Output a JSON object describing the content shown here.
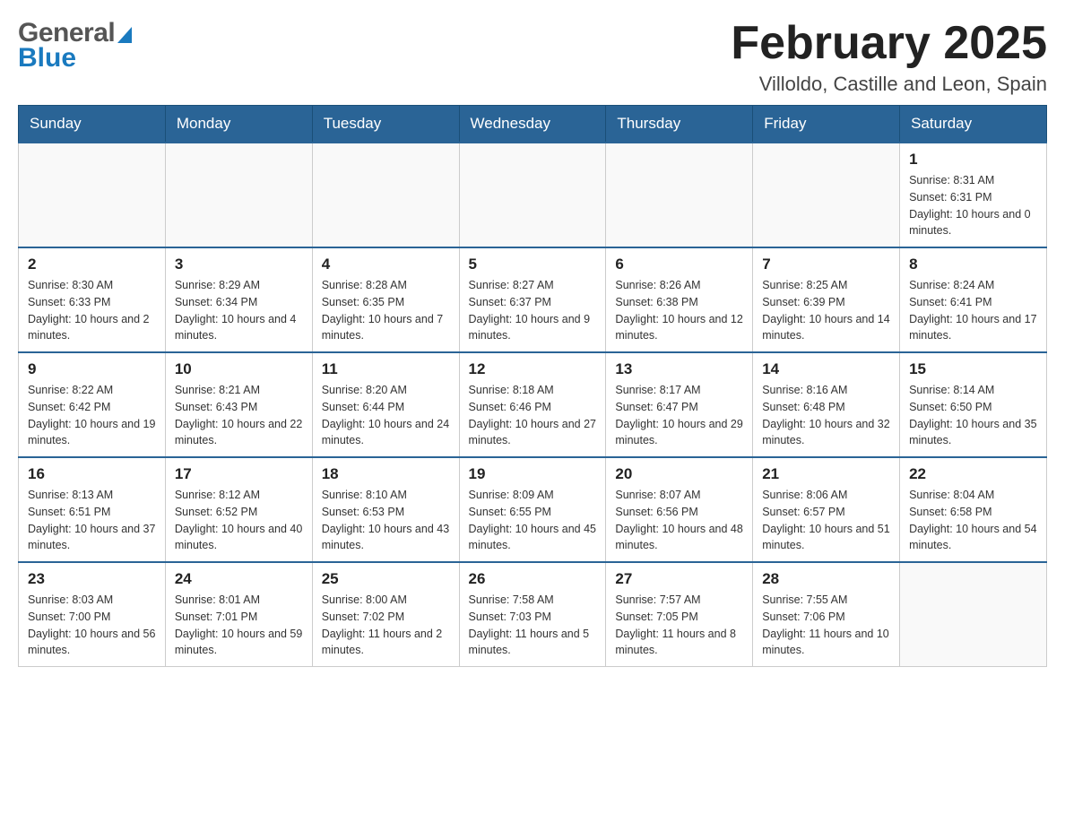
{
  "header": {
    "logo_general": "General",
    "logo_blue": "Blue",
    "month_title": "February 2025",
    "location": "Villoldo, Castille and Leon, Spain"
  },
  "days_of_week": [
    "Sunday",
    "Monday",
    "Tuesday",
    "Wednesday",
    "Thursday",
    "Friday",
    "Saturday"
  ],
  "weeks": [
    [
      {
        "day": "",
        "sunrise": "",
        "sunset": "",
        "daylight": ""
      },
      {
        "day": "",
        "sunrise": "",
        "sunset": "",
        "daylight": ""
      },
      {
        "day": "",
        "sunrise": "",
        "sunset": "",
        "daylight": ""
      },
      {
        "day": "",
        "sunrise": "",
        "sunset": "",
        "daylight": ""
      },
      {
        "day": "",
        "sunrise": "",
        "sunset": "",
        "daylight": ""
      },
      {
        "day": "",
        "sunrise": "",
        "sunset": "",
        "daylight": ""
      },
      {
        "day": "1",
        "sunrise": "Sunrise: 8:31 AM",
        "sunset": "Sunset: 6:31 PM",
        "daylight": "Daylight: 10 hours and 0 minutes."
      }
    ],
    [
      {
        "day": "2",
        "sunrise": "Sunrise: 8:30 AM",
        "sunset": "Sunset: 6:33 PM",
        "daylight": "Daylight: 10 hours and 2 minutes."
      },
      {
        "day": "3",
        "sunrise": "Sunrise: 8:29 AM",
        "sunset": "Sunset: 6:34 PM",
        "daylight": "Daylight: 10 hours and 4 minutes."
      },
      {
        "day": "4",
        "sunrise": "Sunrise: 8:28 AM",
        "sunset": "Sunset: 6:35 PM",
        "daylight": "Daylight: 10 hours and 7 minutes."
      },
      {
        "day": "5",
        "sunrise": "Sunrise: 8:27 AM",
        "sunset": "Sunset: 6:37 PM",
        "daylight": "Daylight: 10 hours and 9 minutes."
      },
      {
        "day": "6",
        "sunrise": "Sunrise: 8:26 AM",
        "sunset": "Sunset: 6:38 PM",
        "daylight": "Daylight: 10 hours and 12 minutes."
      },
      {
        "day": "7",
        "sunrise": "Sunrise: 8:25 AM",
        "sunset": "Sunset: 6:39 PM",
        "daylight": "Daylight: 10 hours and 14 minutes."
      },
      {
        "day": "8",
        "sunrise": "Sunrise: 8:24 AM",
        "sunset": "Sunset: 6:41 PM",
        "daylight": "Daylight: 10 hours and 17 minutes."
      }
    ],
    [
      {
        "day": "9",
        "sunrise": "Sunrise: 8:22 AM",
        "sunset": "Sunset: 6:42 PM",
        "daylight": "Daylight: 10 hours and 19 minutes."
      },
      {
        "day": "10",
        "sunrise": "Sunrise: 8:21 AM",
        "sunset": "Sunset: 6:43 PM",
        "daylight": "Daylight: 10 hours and 22 minutes."
      },
      {
        "day": "11",
        "sunrise": "Sunrise: 8:20 AM",
        "sunset": "Sunset: 6:44 PM",
        "daylight": "Daylight: 10 hours and 24 minutes."
      },
      {
        "day": "12",
        "sunrise": "Sunrise: 8:18 AM",
        "sunset": "Sunset: 6:46 PM",
        "daylight": "Daylight: 10 hours and 27 minutes."
      },
      {
        "day": "13",
        "sunrise": "Sunrise: 8:17 AM",
        "sunset": "Sunset: 6:47 PM",
        "daylight": "Daylight: 10 hours and 29 minutes."
      },
      {
        "day": "14",
        "sunrise": "Sunrise: 8:16 AM",
        "sunset": "Sunset: 6:48 PM",
        "daylight": "Daylight: 10 hours and 32 minutes."
      },
      {
        "day": "15",
        "sunrise": "Sunrise: 8:14 AM",
        "sunset": "Sunset: 6:50 PM",
        "daylight": "Daylight: 10 hours and 35 minutes."
      }
    ],
    [
      {
        "day": "16",
        "sunrise": "Sunrise: 8:13 AM",
        "sunset": "Sunset: 6:51 PM",
        "daylight": "Daylight: 10 hours and 37 minutes."
      },
      {
        "day": "17",
        "sunrise": "Sunrise: 8:12 AM",
        "sunset": "Sunset: 6:52 PM",
        "daylight": "Daylight: 10 hours and 40 minutes."
      },
      {
        "day": "18",
        "sunrise": "Sunrise: 8:10 AM",
        "sunset": "Sunset: 6:53 PM",
        "daylight": "Daylight: 10 hours and 43 minutes."
      },
      {
        "day": "19",
        "sunrise": "Sunrise: 8:09 AM",
        "sunset": "Sunset: 6:55 PM",
        "daylight": "Daylight: 10 hours and 45 minutes."
      },
      {
        "day": "20",
        "sunrise": "Sunrise: 8:07 AM",
        "sunset": "Sunset: 6:56 PM",
        "daylight": "Daylight: 10 hours and 48 minutes."
      },
      {
        "day": "21",
        "sunrise": "Sunrise: 8:06 AM",
        "sunset": "Sunset: 6:57 PM",
        "daylight": "Daylight: 10 hours and 51 minutes."
      },
      {
        "day": "22",
        "sunrise": "Sunrise: 8:04 AM",
        "sunset": "Sunset: 6:58 PM",
        "daylight": "Daylight: 10 hours and 54 minutes."
      }
    ],
    [
      {
        "day": "23",
        "sunrise": "Sunrise: 8:03 AM",
        "sunset": "Sunset: 7:00 PM",
        "daylight": "Daylight: 10 hours and 56 minutes."
      },
      {
        "day": "24",
        "sunrise": "Sunrise: 8:01 AM",
        "sunset": "Sunset: 7:01 PM",
        "daylight": "Daylight: 10 hours and 59 minutes."
      },
      {
        "day": "25",
        "sunrise": "Sunrise: 8:00 AM",
        "sunset": "Sunset: 7:02 PM",
        "daylight": "Daylight: 11 hours and 2 minutes."
      },
      {
        "day": "26",
        "sunrise": "Sunrise: 7:58 AM",
        "sunset": "Sunset: 7:03 PM",
        "daylight": "Daylight: 11 hours and 5 minutes."
      },
      {
        "day": "27",
        "sunrise": "Sunrise: 7:57 AM",
        "sunset": "Sunset: 7:05 PM",
        "daylight": "Daylight: 11 hours and 8 minutes."
      },
      {
        "day": "28",
        "sunrise": "Sunrise: 7:55 AM",
        "sunset": "Sunset: 7:06 PM",
        "daylight": "Daylight: 11 hours and 10 minutes."
      },
      {
        "day": "",
        "sunrise": "",
        "sunset": "",
        "daylight": ""
      }
    ]
  ]
}
